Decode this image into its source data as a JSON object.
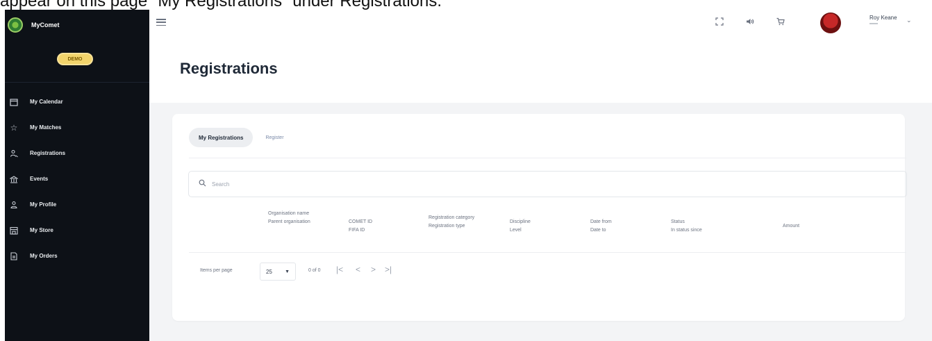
{
  "caption": "appear on this page \"My Registrations\" under Registrations.",
  "sidebar": {
    "brand": "MyComet",
    "badge": "DEMO",
    "items": [
      {
        "label": "My Calendar",
        "icon": "calendar-icon"
      },
      {
        "label": "My Matches",
        "icon": "star-icon"
      },
      {
        "label": "Registrations",
        "icon": "registrations-icon"
      },
      {
        "label": "Events",
        "icon": "events-icon"
      },
      {
        "label": "My Profile",
        "icon": "profile-icon"
      },
      {
        "label": "My Store",
        "icon": "store-icon"
      },
      {
        "label": "My Orders",
        "icon": "orders-icon"
      }
    ]
  },
  "topbar": {
    "icons": [
      "menu-icon",
      "fullscreen-icon",
      "volume-icon",
      "cart-icon",
      "avatar"
    ],
    "user_name": "Roy Keane"
  },
  "page": {
    "title": "Registrations"
  },
  "tabs": [
    {
      "label": "My Registrations",
      "active": true
    },
    {
      "label": "Register",
      "active": false
    }
  ],
  "search": {
    "placeholder": "Search"
  },
  "table": {
    "columns": [
      "Organisation name\nParent organisation",
      "COMET ID\nFIFA ID",
      "Registration category\nRegistration type",
      "Discipline\nLevel",
      "Date from\nDate to",
      "Status\nIn status since",
      "Amount"
    ],
    "rows": []
  },
  "paginator": {
    "items_per_page_label": "Items per page",
    "page_size": "25",
    "range_label": "0 of 0"
  },
  "colors": {
    "sidebar_bg": "#0d1117",
    "badge": "#f2d46b",
    "content_bg": "#f3f4f6",
    "tab_active_bg": "#eceef1",
    "tab_inactive_text": "#7a8aa8"
  }
}
